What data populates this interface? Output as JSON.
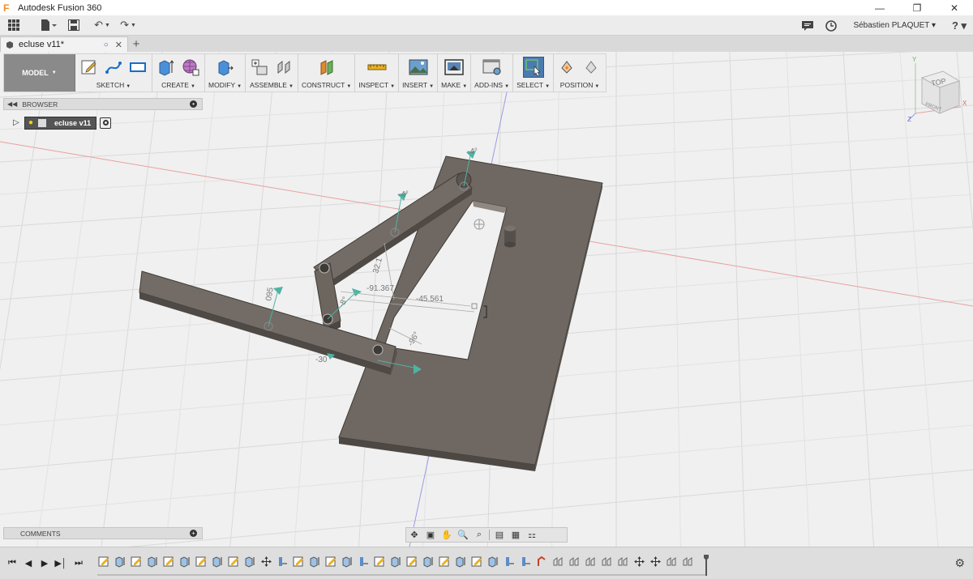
{
  "window": {
    "app_title": "Autodesk Fusion 360",
    "app_icon": "fusion-logo-icon",
    "controls": [
      "minimize",
      "restore",
      "close"
    ]
  },
  "appbar": {
    "user_name": "Sébastien PLAQUET ▾",
    "help_label": "? ▾"
  },
  "tabs": {
    "document_name": "ecluse v11*",
    "new_tab": "+"
  },
  "toolbar": {
    "workspace": "MODEL",
    "groups": [
      {
        "label": "SKETCH",
        "icons": [
          "create-sketch-icon",
          "spline-icon",
          "rectangle-icon"
        ]
      },
      {
        "label": "CREATE",
        "icons": [
          "extrude-icon",
          "form-icon"
        ]
      },
      {
        "label": "MODIFY",
        "icons": [
          "press-pull-icon"
        ]
      },
      {
        "label": "ASSEMBLE",
        "icons": [
          "new-component-icon",
          "joint-icon"
        ]
      },
      {
        "label": "CONSTRUCT",
        "icons": [
          "offset-plane-icon"
        ]
      },
      {
        "label": "INSPECT",
        "icons": [
          "measure-icon"
        ]
      },
      {
        "label": "INSERT",
        "icons": [
          "insert-image-icon"
        ]
      },
      {
        "label": "MAKE",
        "icons": [
          "make-icon"
        ]
      },
      {
        "label": "ADD-INS",
        "icons": [
          "scripts-icon"
        ]
      },
      {
        "label": "SELECT",
        "icons": [
          "select-icon"
        ]
      },
      {
        "label": "POSITION",
        "icons": [
          "capture-position-icon",
          "revert-position-icon"
        ]
      }
    ],
    "colors": {
      "active": "#4b7bb0",
      "create_blue": "#4a90d9",
      "construct_orange": "#e08a2e"
    }
  },
  "browser": {
    "title": "BROWSER",
    "root_node": "ecluse v11"
  },
  "comments": {
    "title": "COMMENTS"
  },
  "viewcube": {
    "top": "TOP",
    "front": "FRONT",
    "axis_y": "Y",
    "axis_x": "X",
    "axis_z": "Z"
  },
  "viewport": {
    "dimension_labels": [
      "-4°",
      "-4°",
      "32.1",
      "-91.367",
      "-45.561",
      "095",
      "-8°",
      "-30",
      "-96°"
    ],
    "colors": {
      "part": "#6d665f",
      "part_dark": "#4f4a45",
      "grid": "#d6d6d6",
      "x_axis": "#e07a7a",
      "z_axis": "#7a7aee",
      "joint": "#4fb3a3"
    }
  },
  "navbar": {
    "tools": [
      "orbit-icon",
      "look-at-icon",
      "pan-icon",
      "zoom-icon",
      "fit-icon",
      "display-settings-icon",
      "grid-settings-icon",
      "viewports-icon"
    ]
  },
  "timeline": {
    "playback": [
      "first-icon",
      "previous-icon",
      "play-icon",
      "next-icon",
      "last-icon"
    ],
    "feature_count": 37
  }
}
